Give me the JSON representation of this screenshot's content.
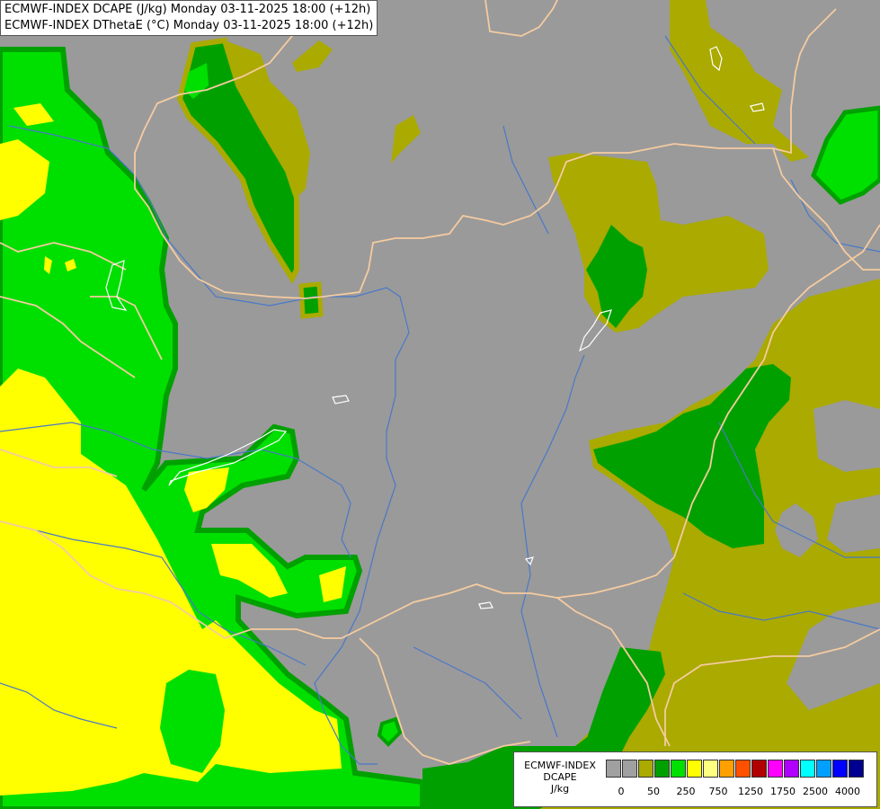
{
  "title_lines": [
    "ECMWF-INDEX DCAPE (J/kg) Monday 03-11-2025 18:00 (+12h)",
    "ECMWF-INDEX DThetaE (°C) Monday 03-11-2025 18:00 (+12h)"
  ],
  "legend": {
    "line1": "ECMWF-INDEX",
    "line2": "DCAPE",
    "line3": "J/kg",
    "swatch_colors": [
      "#a0a0a0",
      "#a0a0a0",
      "#aaaa00",
      "#00a000",
      "#00e000",
      "#ffff00",
      "#ffff80",
      "#ffa000",
      "#ff5000",
      "#b00000",
      "#ff00ff",
      "#b000ff",
      "#00ffff",
      "#00a0ff",
      "#0000ff",
      "#000090"
    ],
    "ticks": [
      "0",
      "50",
      "250",
      "750",
      "1250",
      "1750",
      "2500",
      "4000"
    ]
  },
  "colors": {
    "background": "#9a9a9a",
    "olive": "#aaaa00",
    "dark_green": "#00a000",
    "light_green": "#00e000",
    "yellow": "#ffff00",
    "border": "#f5cba0",
    "river": "#4a78c8",
    "lake": "#ffffff"
  }
}
